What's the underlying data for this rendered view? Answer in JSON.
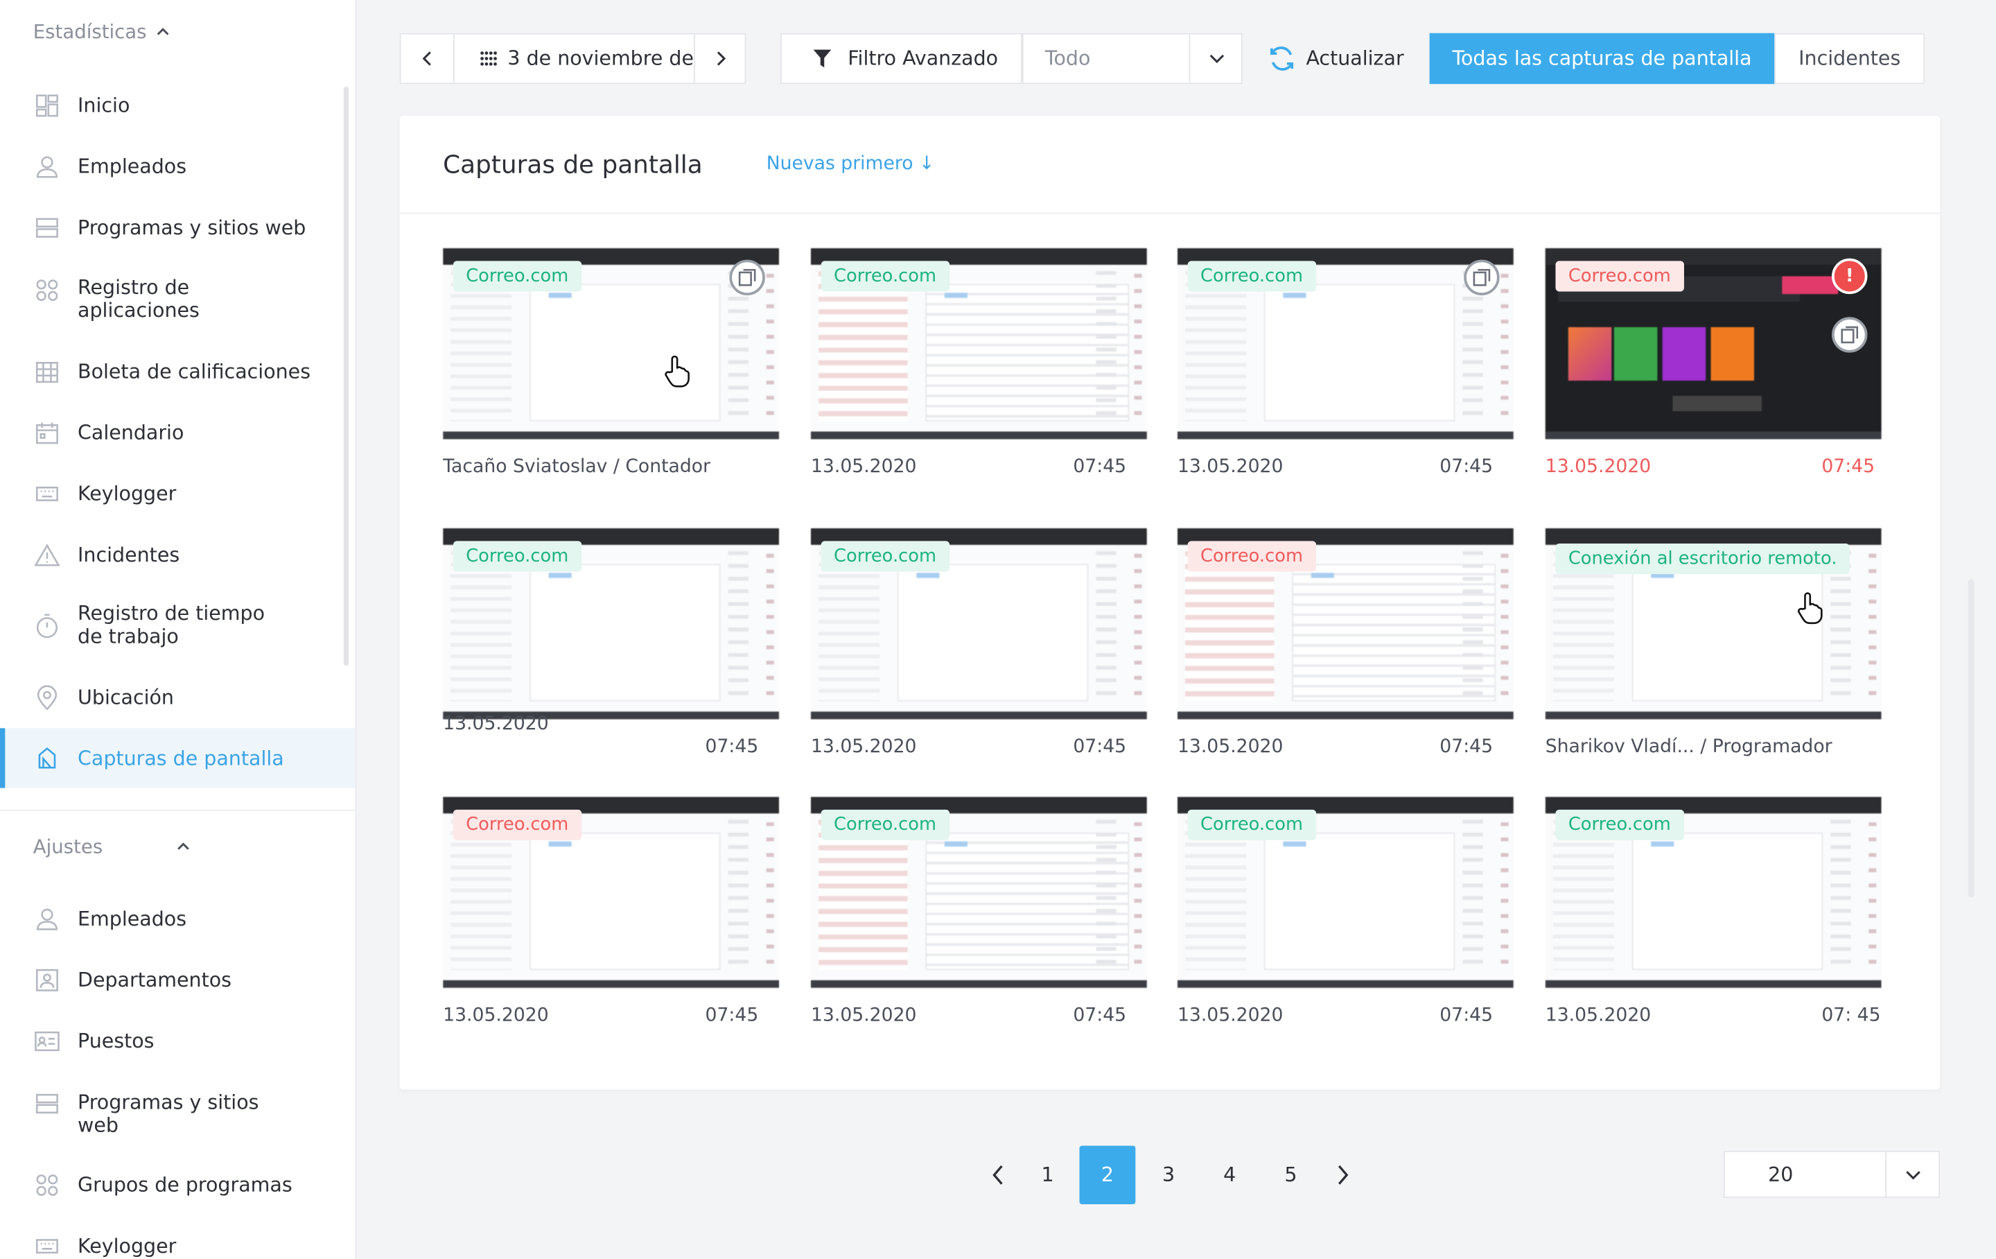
{
  "sidebar": {
    "stats_header": "Estadísticas",
    "stats_items": [
      {
        "label": "Inicio",
        "icon": "dashboard-icon"
      },
      {
        "label": "Empleados",
        "icon": "user-icon"
      },
      {
        "label": "Programas y sitios web",
        "icon": "window-icon"
      },
      {
        "label": "Registro de aplicaciones",
        "icon": "apps-grid-icon"
      },
      {
        "label": "Boleta de calificaciones",
        "icon": "table-icon"
      },
      {
        "label": "Calendario",
        "icon": "calendar-icon"
      },
      {
        "label": "Keylogger",
        "icon": "keyboard-icon"
      },
      {
        "label": "Incidentes",
        "icon": "warning-icon"
      },
      {
        "label": "Registro de tiempo de trabajo",
        "icon": "stopwatch-icon"
      },
      {
        "label": "Ubicación",
        "icon": "location-pin-icon"
      },
      {
        "label": "Capturas de pantalla",
        "icon": "screenshots-icon",
        "active": true
      }
    ],
    "settings_header": "Ajustes",
    "settings_items": [
      {
        "label": "Empleados",
        "icon": "user-icon"
      },
      {
        "label": "Departamentos",
        "icon": "department-icon"
      },
      {
        "label": "Puestos",
        "icon": "id-card-icon"
      },
      {
        "label": "Programas y sitios web",
        "icon": "window-icon"
      },
      {
        "label": "Grupos de programas",
        "icon": "apps-grid-icon"
      },
      {
        "label": "Keylogger",
        "icon": "keyboard-icon"
      }
    ]
  },
  "toolbar": {
    "date_label": "3 de noviembre de",
    "filter_label": "Filtro Avanzado",
    "select_value": "Todo",
    "refresh_label": "Actualizar",
    "tab_all": "Todas las capturas de pantalla",
    "tab_incidents": "Incidentes"
  },
  "card": {
    "title": "Capturas de pantalla",
    "sort_label": "Nuevas primero ↓"
  },
  "shots": [
    {
      "tag": "Correo.com",
      "tag_color": "green",
      "caption_left": "Tacaño Sviatoslav / Contador",
      "caption_right": "",
      "copy_icon": true
    },
    {
      "tag": "Correo.com",
      "tag_color": "green",
      "caption_left": "13.05.2020",
      "caption_right": "07:45"
    },
    {
      "tag": "Correo.com",
      "tag_color": "green",
      "caption_left": "13.05.2020",
      "caption_right": "07:45",
      "copy_icon": true
    },
    {
      "tag": "Correo.com",
      "tag_color": "red",
      "caption_left": "13.05.2020",
      "caption_right": "07:45",
      "alert": "!",
      "caption_color": "red"
    },
    {
      "tag": "Correo.com",
      "tag_color": "green",
      "caption_left": "13.05.2020",
      "caption_right": "07:45"
    },
    {
      "tag": "Correo.com",
      "tag_color": "green",
      "caption_left": "13.05.2020",
      "caption_right": "07:45"
    },
    {
      "tag": "Correo.com",
      "tag_color": "red",
      "caption_left": "13.05.2020",
      "caption_right": "07:45"
    },
    {
      "tag": "Conexión al escritorio remoto.",
      "tag_color": "green",
      "caption_left": "Sharikov Vladí... / Programador",
      "caption_right": ""
    },
    {
      "tag": "Correo.com",
      "tag_color": "red",
      "caption_left": "13.05.2020",
      "caption_right": "07:45"
    },
    {
      "tag": "Correo.com",
      "tag_color": "green",
      "caption_left": "13.05.2020",
      "caption_right": "07:45"
    },
    {
      "tag": "Correo.com",
      "tag_color": "green",
      "caption_left": "13.05.2020",
      "caption_right": "07:45"
    },
    {
      "tag": "Correo.com",
      "tag_color": "green",
      "caption_left": "13.05.2020",
      "caption_right": "07: 45"
    }
  ],
  "pagination": {
    "pages": [
      "1",
      "2",
      "3",
      "4",
      "5"
    ],
    "current": "2",
    "per_page": "20"
  },
  "colors": {
    "accent": "#3cabeb",
    "tag_green": "#1db380",
    "tag_red": "#ef5b5b"
  }
}
